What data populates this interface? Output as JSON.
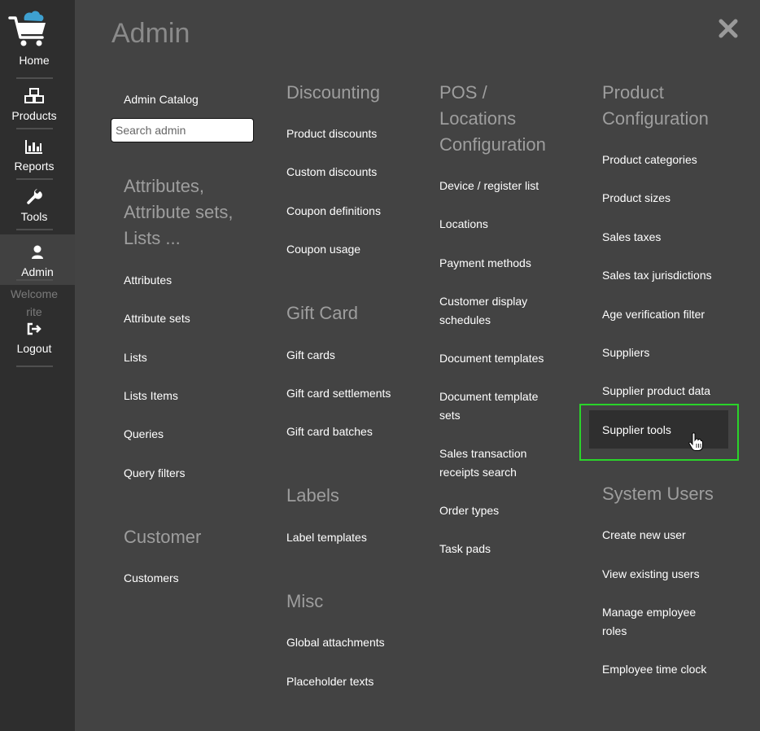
{
  "sidebar": {
    "items": [
      {
        "label": "Home",
        "icon": "cart-icon"
      },
      {
        "label": "Products",
        "icon": "boxes-icon"
      },
      {
        "label": "Reports",
        "icon": "bar-chart-icon"
      },
      {
        "label": "Tools",
        "icon": "wrench-icon"
      },
      {
        "label": "Admin",
        "icon": "user-icon",
        "active": true
      }
    ],
    "welcome": "Welcome",
    "username": "rite",
    "logout": {
      "label": "Logout",
      "icon": "sign-out-icon"
    }
  },
  "header": {
    "title": "Admin",
    "close_icon": "close-icon"
  },
  "columns": {
    "col1": {
      "admin_catalog": "Admin Catalog",
      "search_placeholder": "Search admin",
      "attributes_title": [
        "Attributes,",
        "Attribute sets,",
        "Lists ..."
      ],
      "attributes_items": [
        "Attributes",
        "Attribute sets",
        "Lists",
        "Lists Items",
        "Queries",
        "Query filters"
      ],
      "customer_title": "Customer",
      "customer_items": [
        "Customers"
      ]
    },
    "col2": {
      "discounting_title": "Discounting",
      "discounting_items": [
        "Product discounts",
        "Custom discounts",
        "Coupon definitions",
        "Coupon usage"
      ],
      "giftcard_title": "Gift Card",
      "giftcard_items": [
        "Gift cards",
        "Gift card settlements",
        "Gift card batches"
      ],
      "labels_title": "Labels",
      "labels_items": [
        "Label templates"
      ],
      "misc_title": "Misc",
      "misc_items": [
        "Global attachments",
        "Placeholder texts"
      ]
    },
    "col3": {
      "pos_title": [
        "POS /",
        "Locations",
        "Configuration"
      ],
      "pos_items": [
        [
          "Device / register list"
        ],
        [
          "Locations"
        ],
        [
          "Payment methods"
        ],
        [
          "Customer display",
          "schedules"
        ],
        [
          "Document templates"
        ],
        [
          "Document template",
          "sets"
        ],
        [
          "Sales transaction",
          "receipts search"
        ],
        [
          "Order types"
        ],
        [
          "Task pads"
        ]
      ]
    },
    "col4": {
      "product_title": [
        "Product",
        "Configuration"
      ],
      "product_items": [
        "Product categories",
        "Product sizes",
        "Sales taxes",
        "Sales tax jurisdictions",
        "Age verification filter",
        "Suppliers",
        "Supplier product data",
        "Supplier tools"
      ],
      "users_title": "System Users",
      "users_items": [
        [
          "Create new user"
        ],
        [
          "View existing users"
        ],
        [
          "Manage employee",
          "roles"
        ],
        [
          "Employee time clock"
        ]
      ]
    }
  },
  "colors": {
    "highlight": "#2ad42a",
    "heading": "#9e9e9e",
    "sidebar_bg": "#2e2e2e",
    "panel_bg": "#434343"
  }
}
